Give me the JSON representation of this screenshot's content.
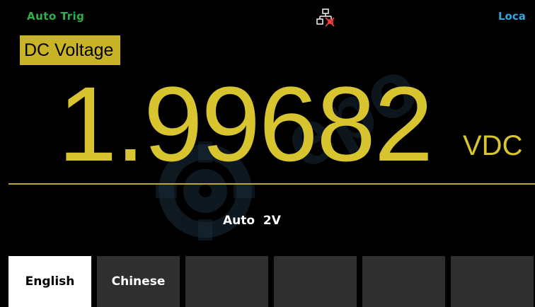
{
  "status": {
    "trigger_mode": "Auto Trig",
    "remote_state": "Loca"
  },
  "measurement": {
    "function": "DC Voltage",
    "value": "1.99682",
    "unit": "VDC",
    "range": "Auto  2V"
  },
  "softkeys": [
    {
      "label": "English",
      "active": true
    },
    {
      "label": "Chinese",
      "active": false
    },
    {
      "label": "",
      "active": false
    },
    {
      "label": "",
      "active": false
    },
    {
      "label": "",
      "active": false
    },
    {
      "label": "",
      "active": false
    }
  ],
  "colors": {
    "background": "#000000",
    "reading": "#d8c42e",
    "title_bg": "#c9b427",
    "trigger_text": "#2bb24c",
    "remote_text": "#2ea6e6",
    "softkey_bg": "#2f2f2f"
  },
  "icons": {
    "lan_status": "network-disconnected-icon"
  }
}
